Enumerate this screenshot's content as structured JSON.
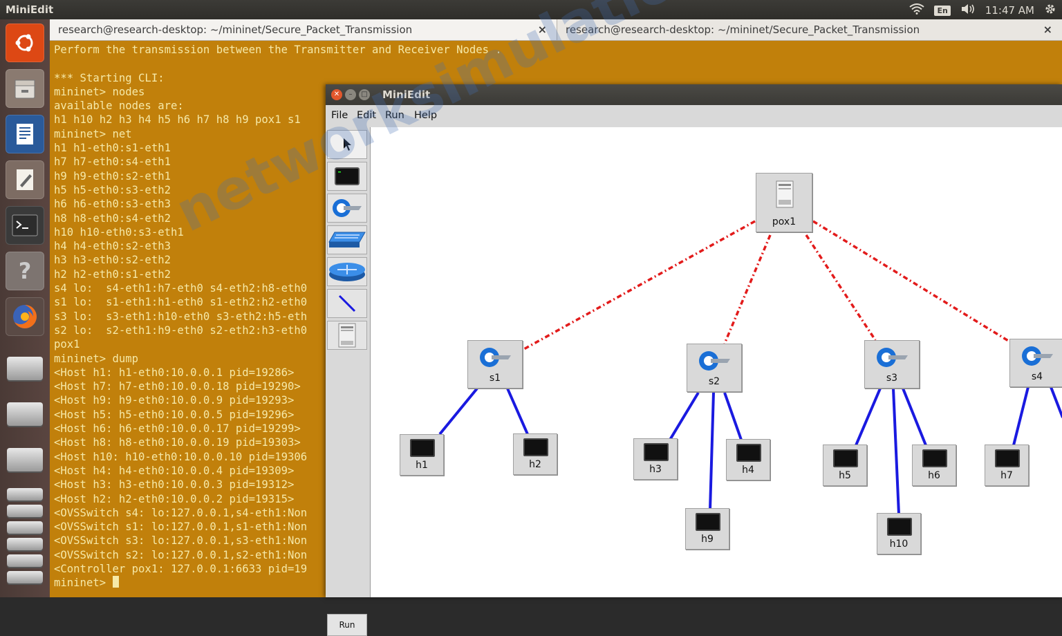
{
  "topbar": {
    "app_name": "MiniEdit",
    "keyboard": "En",
    "time": "11:47 AM",
    "icons": [
      "wifi-icon",
      "volume-icon",
      "gear-icon"
    ]
  },
  "launcher": {
    "items": [
      "ubuntu-logo",
      "files",
      "writer",
      "text-editor",
      "terminal",
      "help",
      "firefox",
      "drive",
      "drive",
      "drive",
      "drive-stack"
    ]
  },
  "terminal": {
    "tabs": [
      {
        "label": "research@research-desktop: ~/mininet/Secure_Packet_Transmission",
        "close": "×"
      },
      {
        "label": "research@research-desktop: ~/mininet/Secure_Packet_Transmission",
        "close": "×"
      }
    ],
    "text": "Perform the transmission between the Transmitter and Receiver Nodes .\n\n*** Starting CLI:\nmininet> nodes\navailable nodes are:\nh1 h10 h2 h3 h4 h5 h6 h7 h8 h9 pox1 s1\nmininet> net\nh1 h1-eth0:s1-eth1\nh7 h7-eth0:s4-eth1\nh9 h9-eth0:s2-eth1\nh5 h5-eth0:s3-eth2\nh6 h6-eth0:s3-eth3\nh8 h8-eth0:s4-eth2\nh10 h10-eth0:s3-eth1\nh4 h4-eth0:s2-eth3\nh3 h3-eth0:s2-eth2\nh2 h2-eth0:s1-eth2\ns4 lo:  s4-eth1:h7-eth0 s4-eth2:h8-eth0\ns1 lo:  s1-eth1:h1-eth0 s1-eth2:h2-eth0\ns3 lo:  s3-eth1:h10-eth0 s3-eth2:h5-eth\ns2 lo:  s2-eth1:h9-eth0 s2-eth2:h3-eth0\npox1\nmininet> dump\n<Host h1: h1-eth0:10.0.0.1 pid=19286>\n<Host h7: h7-eth0:10.0.0.18 pid=19290>\n<Host h9: h9-eth0:10.0.0.9 pid=19293>\n<Host h5: h5-eth0:10.0.0.5 pid=19296>\n<Host h6: h6-eth0:10.0.0.17 pid=19299>\n<Host h8: h8-eth0:10.0.0.19 pid=19303>\n<Host h10: h10-eth0:10.0.0.10 pid=19306\n<Host h4: h4-eth0:10.0.0.4 pid=19309>\n<Host h3: h3-eth0:10.0.0.3 pid=19312>\n<Host h2: h2-eth0:10.0.0.2 pid=19315>\n<OVSSwitch s4: lo:127.0.0.1,s4-eth1:Non\n<OVSSwitch s1: lo:127.0.0.1,s1-eth1:Non\n<OVSSwitch s3: lo:127.0.0.1,s3-eth1:Non\n<OVSSwitch s2: lo:127.0.0.1,s2-eth1:Non\n<Controller pox1: 127.0.0.1:6633 pid=19\nmininet> ",
    "colors": {
      "background": "#c1800b",
      "foreground": "#f6e9a8"
    }
  },
  "miniedit": {
    "title": "MiniEdit",
    "menu": [
      "File",
      "Edit",
      "Run",
      "Help"
    ],
    "tools": [
      "select-tool",
      "host-tool",
      "switch-tool",
      "legacy-switch-tool",
      "router-tool",
      "link-tool",
      "controller-tool"
    ],
    "run_label": "Run",
    "controller": {
      "label": "pox1"
    },
    "switches": [
      {
        "label": "s1"
      },
      {
        "label": "s2"
      },
      {
        "label": "s3"
      },
      {
        "label": "s4"
      }
    ],
    "hosts": [
      {
        "label": "h1"
      },
      {
        "label": "h2"
      },
      {
        "label": "h3"
      },
      {
        "label": "h4"
      },
      {
        "label": "h9"
      },
      {
        "label": "h5"
      },
      {
        "label": "h6"
      },
      {
        "label": "h10"
      },
      {
        "label": "h7"
      }
    ],
    "colors": {
      "control_link": "#e21b1b",
      "data_link": "#1a1ae0"
    }
  },
  "watermark": "networksimulationtools.com"
}
